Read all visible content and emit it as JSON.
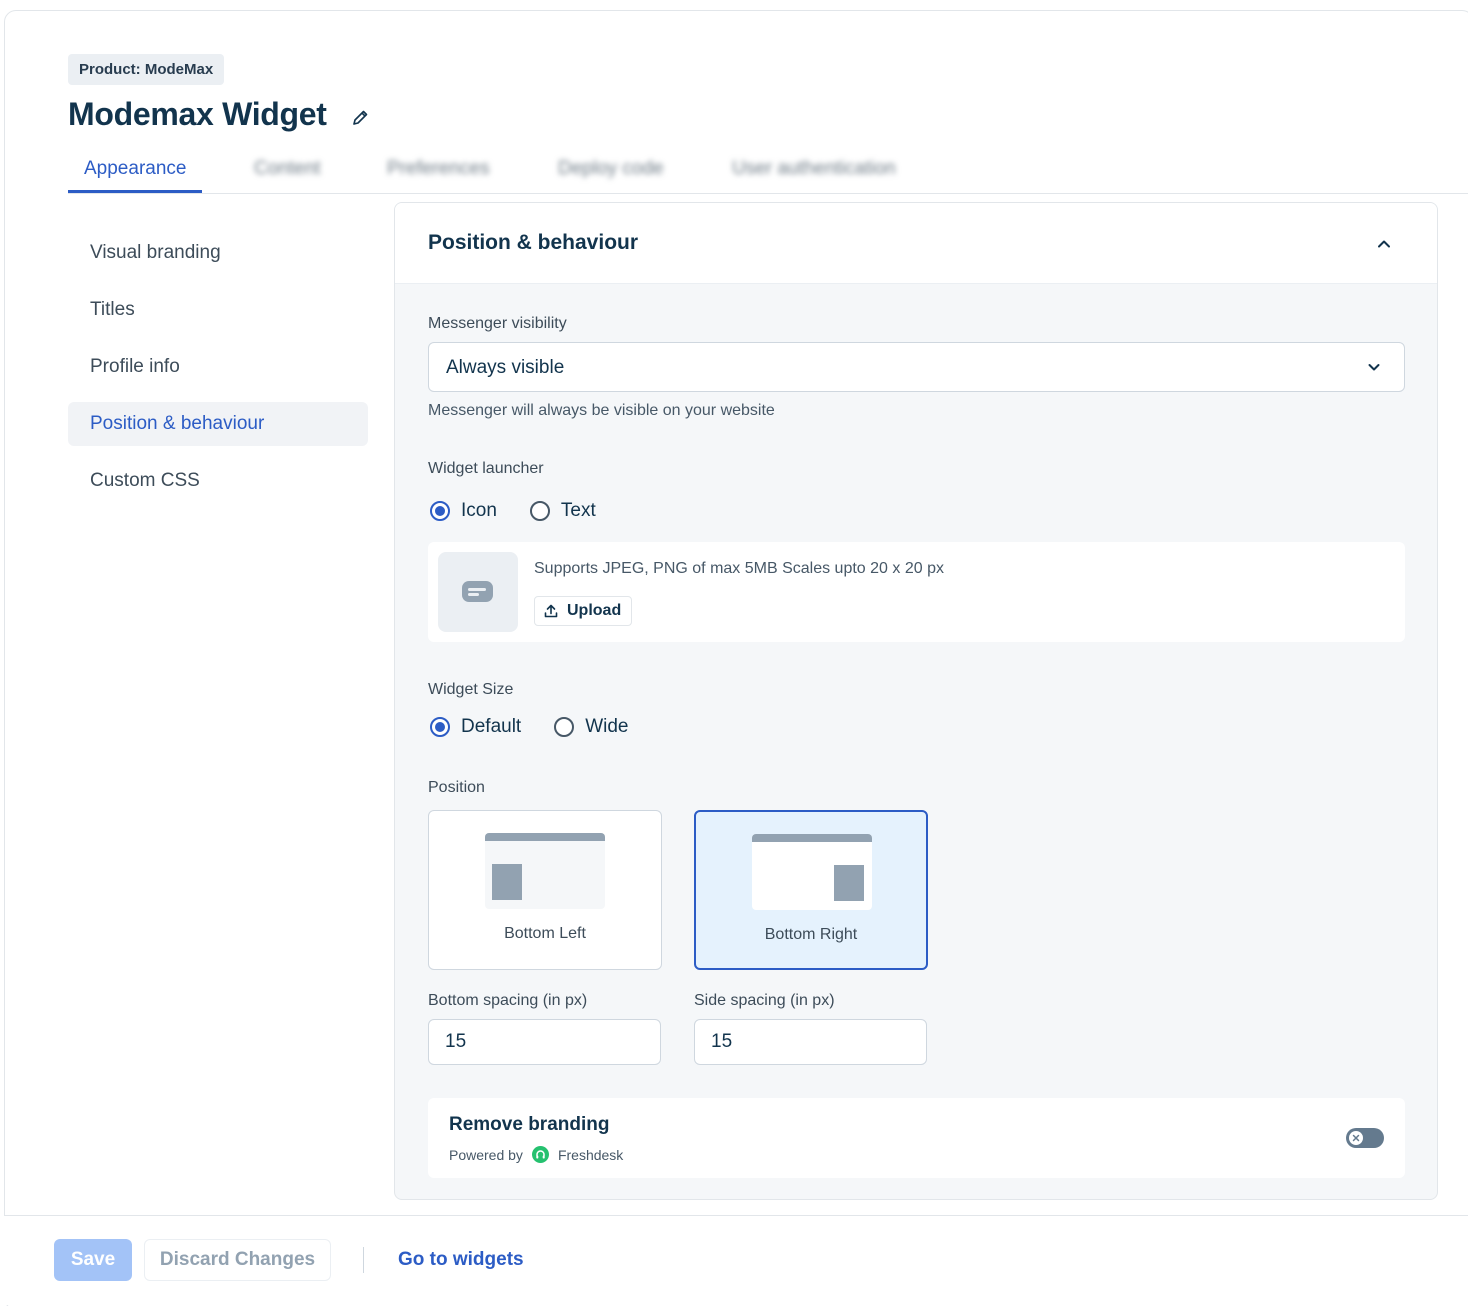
{
  "header": {
    "product_badge": "Product: ModeMax",
    "title": "Modemax Widget"
  },
  "tabs": [
    {
      "label": "Appearance",
      "active": true
    },
    {
      "label": "Content"
    },
    {
      "label": "Preferences"
    },
    {
      "label": "Deploy code"
    },
    {
      "label": "User authentication"
    }
  ],
  "sidebar": {
    "items": [
      {
        "label": "Visual branding"
      },
      {
        "label": "Titles"
      },
      {
        "label": "Profile info"
      },
      {
        "label": "Position & behaviour",
        "active": true
      },
      {
        "label": "Custom CSS"
      }
    ]
  },
  "panel": {
    "title": "Position & behaviour",
    "visibility": {
      "label": "Messenger visibility",
      "value": "Always visible",
      "hint": "Messenger will always be visible on your website"
    },
    "launcher": {
      "label": "Widget launcher",
      "options": [
        "Icon",
        "Text"
      ],
      "selected": "Icon",
      "upload_hint": "Supports JPEG, PNG of max 5MB Scales upto 20 x 20 px",
      "upload_label": "Upload"
    },
    "size": {
      "label": "Widget Size",
      "options": [
        "Default",
        "Wide"
      ],
      "selected": "Default"
    },
    "position": {
      "label": "Position",
      "options": [
        "Bottom Left",
        "Bottom Right"
      ],
      "selected": "Bottom Right"
    },
    "spacing": {
      "bottom_label": "Bottom spacing (in px)",
      "bottom_value": "15",
      "side_label": "Side spacing (in px)",
      "side_value": "15"
    },
    "branding": {
      "title": "Remove branding",
      "powered_by": "Powered by",
      "brand": "Freshdesk",
      "enabled": false
    }
  },
  "footer": {
    "save_label": "Save",
    "discard_label": "Discard Changes",
    "widgets_link": "Go to widgets"
  },
  "colors": {
    "accent": "#2c5cc5",
    "text": "#12344d",
    "brand_green": "#25c16f"
  }
}
